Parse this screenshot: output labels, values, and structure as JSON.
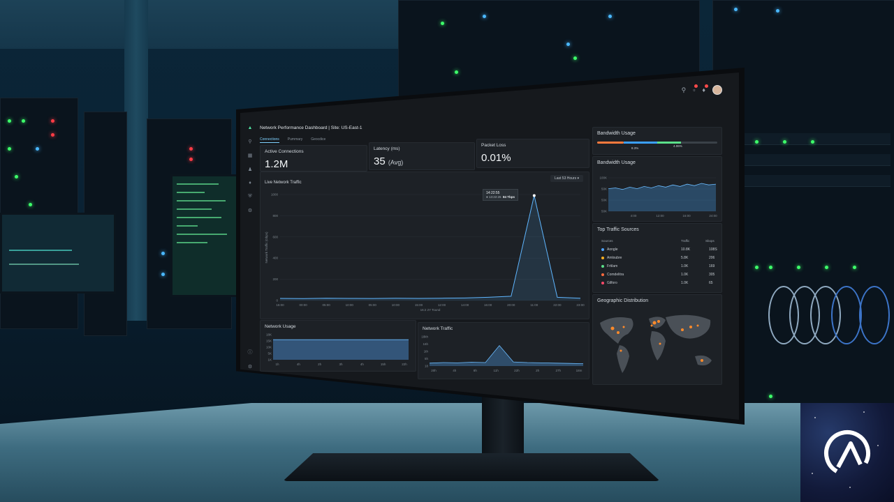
{
  "header": {
    "title": "Network Performance Dashboard | Site: US-East-1",
    "tabs": [
      "Connections",
      "Pummary",
      "Geocdice"
    ]
  },
  "kpis": [
    {
      "label": "Active Connections",
      "value": "1.2M",
      "unit": ""
    },
    {
      "label": "Latency (ms)",
      "value": "35",
      "unit": "(Avg)"
    },
    {
      "label": "Packet Loss",
      "value": "0.01%",
      "unit": ""
    }
  ],
  "live_traffic": {
    "title": "Live Network Traffic",
    "range_select": "Last 53 Hours",
    "ylabel": "Network Traffic (Gbps)",
    "xlabel": "16:2 2Y Tound",
    "tooltip_time": "14:22:55",
    "tooltip_sub": "13:22:26",
    "tooltip_value": "84 Tbps"
  },
  "bandwidth_top": {
    "title": "Bandwidth Usage",
    "marker_a": "8.3%",
    "marker_b": "4.06%"
  },
  "bandwidth_chart": {
    "title": "Bandwidth Usage"
  },
  "top_sources": {
    "title": "Top Traffic Sources",
    "headers": [
      "Sources",
      "Traffic",
      "Sbops"
    ],
    "rows": [
      {
        "name": "Aongle",
        "traffic": "10.8K",
        "sbops": "108S",
        "color": "#4fa3ff"
      },
      {
        "name": "Amloubre",
        "traffic": "5.8K",
        "sbops": "206",
        "color": "#ffb020"
      },
      {
        "name": "Frtilam",
        "traffic": "1.0K",
        "sbops": "169",
        "color": "#5be08a"
      },
      {
        "name": "Comdelitra",
        "traffic": "1.0K",
        "sbops": "305",
        "color": "#ff6a3d"
      },
      {
        "name": "Gilforo",
        "traffic": "1.0K",
        "sbops": "65",
        "color": "#ff4a6a"
      }
    ]
  },
  "geo": {
    "title": "Geographic Distribution"
  },
  "network_usage": {
    "title": "Network Usage"
  },
  "network_traffic": {
    "title": "Network Traffic"
  },
  "chart_data": [
    {
      "type": "line",
      "title": "Live Network Traffic",
      "ylabel": "Network Traffic (Gbps)",
      "xlabel": "16:2 2Y Tound",
      "x": [
        "15:00",
        "00:00",
        "05:00",
        "10:00",
        "05:00",
        "10:00",
        "15:00",
        "12:00",
        "14:00",
        "16:00",
        "20:00",
        "11:00",
        "22:00",
        "23:00"
      ],
      "yticks": [
        "1000",
        "800",
        "600",
        "400",
        "200",
        "0"
      ],
      "ylim": [
        0,
        1000
      ],
      "values": [
        20,
        18,
        22,
        20,
        19,
        21,
        20,
        22,
        24,
        30,
        40,
        990,
        30,
        22
      ],
      "grid": true
    },
    {
      "type": "area",
      "title": "Bandwidth Usage",
      "x": [
        "4:00",
        "12:00",
        "16:00",
        "24:00"
      ],
      "yticks": [
        "100K",
        "50K",
        "50K",
        "50K"
      ],
      "values": [
        60,
        62,
        58,
        64,
        60,
        66,
        62,
        68,
        64,
        70,
        66,
        72,
        68,
        74,
        70,
        72
      ]
    },
    {
      "type": "area",
      "title": "Network Usage",
      "x": [
        "1h",
        "4h",
        "2h",
        "3h",
        "4h",
        "15h",
        "22h"
      ],
      "yticks": [
        "18K",
        "15K",
        "10K",
        "5K",
        "1K"
      ],
      "values": [
        80,
        80,
        80,
        80,
        80,
        80,
        80
      ]
    },
    {
      "type": "line",
      "title": "Network Traffic",
      "x": [
        "20h",
        "4h",
        "8h",
        "11h",
        "22h",
        "2h",
        "27h",
        "18m"
      ],
      "yticks": [
        "18kh",
        "16h",
        "1th",
        "5h",
        "18"
      ],
      "values": [
        10,
        12,
        11,
        13,
        12,
        70,
        14,
        12,
        11,
        10,
        9,
        8
      ]
    }
  ]
}
